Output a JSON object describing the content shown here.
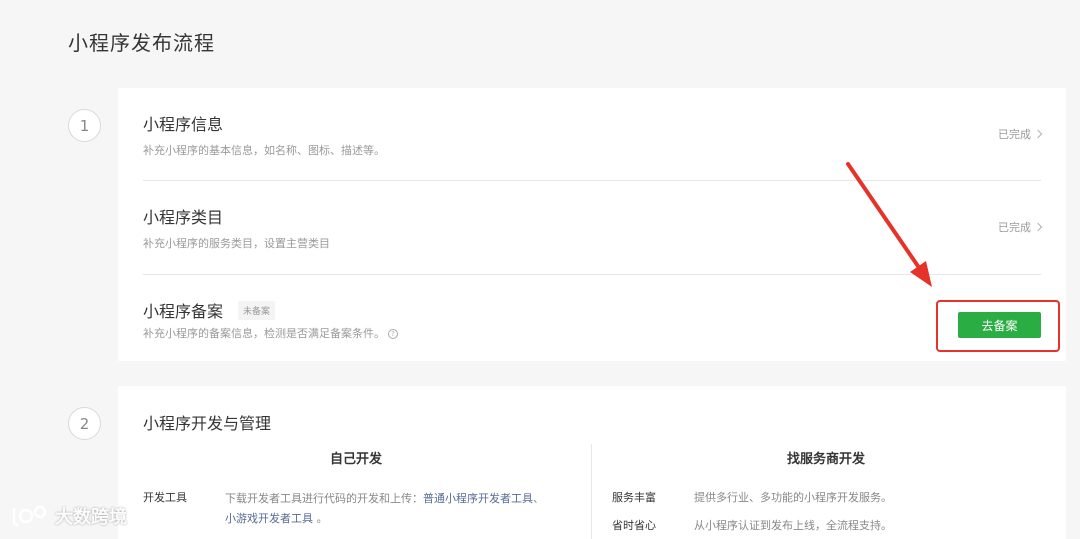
{
  "page_title": "小程序发布流程",
  "step1": {
    "number": "1",
    "items": [
      {
        "title": "小程序信息",
        "desc": "补充小程序的基本信息，如名称、图标、描述等。",
        "status": "已完成"
      },
      {
        "title": "小程序类目",
        "desc": "补充小程序的服务类目，设置主营类目",
        "status": "已完成"
      },
      {
        "title": "小程序备案",
        "badge": "未备案",
        "desc": "补充小程序的备案信息，检测是否满足备案条件。",
        "help": "?",
        "button": "去备案"
      }
    ]
  },
  "step2": {
    "number": "2",
    "title": "小程序开发与管理",
    "left": {
      "heading": "自己开发",
      "rows": [
        {
          "key": "开发工具",
          "text": "下载开发者工具进行代码的开发和上传：",
          "link1": "普通小程序开发者工具",
          "sep": "、",
          "link2": "小游戏开发者工具",
          "end": "。"
        }
      ]
    },
    "right": {
      "heading": "找服务商开发",
      "rows": [
        {
          "key": "服务丰富",
          "text": "提供多行业、多功能的小程序开发服务。"
        },
        {
          "key": "省时省心",
          "text": "从小程序认证到发布上线，全流程支持。"
        }
      ]
    }
  },
  "annotation_color": "#e5332a",
  "accent_color": "#2aae43",
  "watermark": "大数跨境"
}
